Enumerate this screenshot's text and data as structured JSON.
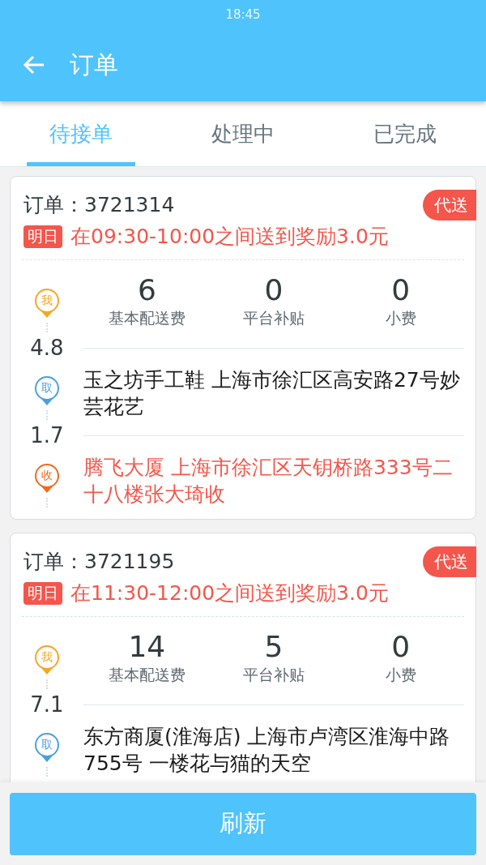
{
  "status_bar": {
    "time": "18:45"
  },
  "toolbar": {
    "title": "订单"
  },
  "tabs": [
    {
      "label": "待接单",
      "selected": true
    },
    {
      "label": "处理中",
      "selected": false
    },
    {
      "label": "已完成",
      "selected": false
    }
  ],
  "orders": [
    {
      "label": "订单：",
      "number": "3721314",
      "badge": "代送",
      "day_tag": "明日",
      "reward": "在09:30-10:00之间送到奖励3.0元",
      "me_pin": "我",
      "fees": [
        {
          "value": "6",
          "label": "基本配送费"
        },
        {
          "value": "0",
          "label": "平台补贴"
        },
        {
          "value": "0",
          "label": "小费"
        }
      ],
      "stops": [
        {
          "kind": "pickup",
          "distance": "4.8",
          "pin": "取",
          "address": "玉之坊手工鞋 上海市徐汇区高安路27号妙芸花艺"
        },
        {
          "kind": "dropoff",
          "distance": "1.7",
          "pin": "收",
          "address": "腾飞大厦 上海市徐汇区天钥桥路333号二十八楼张大琦收"
        }
      ]
    },
    {
      "label": "订单：",
      "number": "3721195",
      "badge": "代送",
      "day_tag": "明日",
      "reward": "在11:30-12:00之间送到奖励3.0元",
      "me_pin": "我",
      "fees": [
        {
          "value": "14",
          "label": "基本配送费"
        },
        {
          "value": "5",
          "label": "平台补贴"
        },
        {
          "value": "0",
          "label": "小费"
        }
      ],
      "stops": [
        {
          "kind": "pickup",
          "distance": "7.1",
          "pin": "取",
          "address": "东方商厦(淮海店) 上海市卢湾区淮海中路755号 一楼花与猫的天空"
        }
      ]
    }
  ],
  "refresh_button": "刷新"
}
